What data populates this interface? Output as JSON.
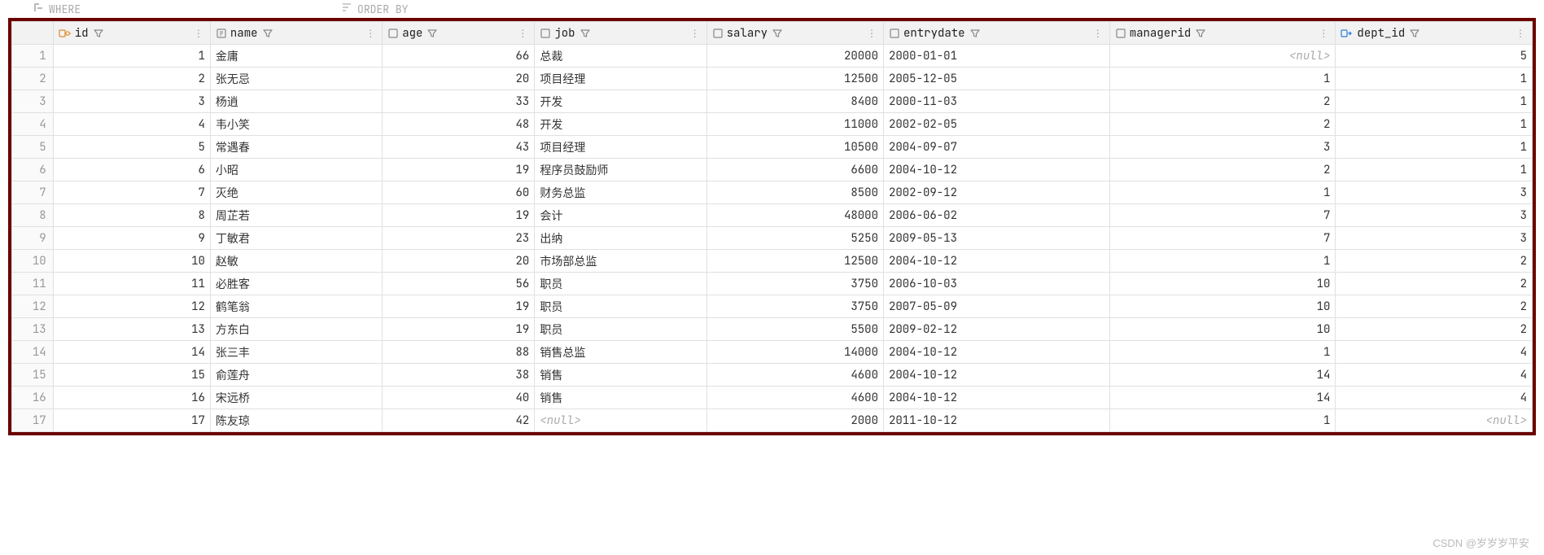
{
  "topbar": {
    "where_label": "WHERE",
    "orderby_label": "ORDER BY"
  },
  "null_display": "<null>",
  "columns": [
    {
      "key": "id",
      "label": "id",
      "icon": "key",
      "align": "num"
    },
    {
      "key": "name",
      "label": "name",
      "icon": "text",
      "align": "text"
    },
    {
      "key": "age",
      "label": "age",
      "icon": "col",
      "align": "num"
    },
    {
      "key": "job",
      "label": "job",
      "icon": "col",
      "align": "text"
    },
    {
      "key": "salary",
      "label": "salary",
      "icon": "col",
      "align": "num"
    },
    {
      "key": "entrydate",
      "label": "entrydate",
      "icon": "col",
      "align": "text"
    },
    {
      "key": "managerid",
      "label": "managerid",
      "icon": "col",
      "align": "num"
    },
    {
      "key": "dept_id",
      "label": "dept_id",
      "icon": "fk",
      "align": "num"
    }
  ],
  "rows": [
    {
      "id": 1,
      "name": "金庸",
      "age": 66,
      "job": "总裁",
      "salary": 20000,
      "entrydate": "2000-01-01",
      "managerid": null,
      "dept_id": 5
    },
    {
      "id": 2,
      "name": "张无忌",
      "age": 20,
      "job": "项目经理",
      "salary": 12500,
      "entrydate": "2005-12-05",
      "managerid": 1,
      "dept_id": 1
    },
    {
      "id": 3,
      "name": "杨逍",
      "age": 33,
      "job": "开发",
      "salary": 8400,
      "entrydate": "2000-11-03",
      "managerid": 2,
      "dept_id": 1
    },
    {
      "id": 4,
      "name": "韦小笑",
      "age": 48,
      "job": "开发",
      "salary": 11000,
      "entrydate": "2002-02-05",
      "managerid": 2,
      "dept_id": 1
    },
    {
      "id": 5,
      "name": "常遇春",
      "age": 43,
      "job": "项目经理",
      "salary": 10500,
      "entrydate": "2004-09-07",
      "managerid": 3,
      "dept_id": 1
    },
    {
      "id": 6,
      "name": "小昭",
      "age": 19,
      "job": "程序员鼓励师",
      "salary": 6600,
      "entrydate": "2004-10-12",
      "managerid": 2,
      "dept_id": 1
    },
    {
      "id": 7,
      "name": "灭绝",
      "age": 60,
      "job": "财务总监",
      "salary": 8500,
      "entrydate": "2002-09-12",
      "managerid": 1,
      "dept_id": 3
    },
    {
      "id": 8,
      "name": "周芷若",
      "age": 19,
      "job": "会计",
      "salary": 48000,
      "entrydate": "2006-06-02",
      "managerid": 7,
      "dept_id": 3
    },
    {
      "id": 9,
      "name": "丁敏君",
      "age": 23,
      "job": "出纳",
      "salary": 5250,
      "entrydate": "2009-05-13",
      "managerid": 7,
      "dept_id": 3
    },
    {
      "id": 10,
      "name": "赵敏",
      "age": 20,
      "job": "市场部总监",
      "salary": 12500,
      "entrydate": "2004-10-12",
      "managerid": 1,
      "dept_id": 2
    },
    {
      "id": 11,
      "name": "必胜客",
      "age": 56,
      "job": "职员",
      "salary": 3750,
      "entrydate": "2006-10-03",
      "managerid": 10,
      "dept_id": 2
    },
    {
      "id": 12,
      "name": "鹤笔翁",
      "age": 19,
      "job": "职员",
      "salary": 3750,
      "entrydate": "2007-05-09",
      "managerid": 10,
      "dept_id": 2
    },
    {
      "id": 13,
      "name": "方东白",
      "age": 19,
      "job": "职员",
      "salary": 5500,
      "entrydate": "2009-02-12",
      "managerid": 10,
      "dept_id": 2
    },
    {
      "id": 14,
      "name": "张三丰",
      "age": 88,
      "job": "销售总监",
      "salary": 14000,
      "entrydate": "2004-10-12",
      "managerid": 1,
      "dept_id": 4
    },
    {
      "id": 15,
      "name": "俞莲舟",
      "age": 38,
      "job": "销售",
      "salary": 4600,
      "entrydate": "2004-10-12",
      "managerid": 14,
      "dept_id": 4
    },
    {
      "id": 16,
      "name": "宋远桥",
      "age": 40,
      "job": "销售",
      "salary": 4600,
      "entrydate": "2004-10-12",
      "managerid": 14,
      "dept_id": 4
    },
    {
      "id": 17,
      "name": "陈友琼",
      "age": 42,
      "job": null,
      "salary": 2000,
      "entrydate": "2011-10-12",
      "managerid": 1,
      "dept_id": null
    }
  ],
  "watermark": "CSDN @岁岁岁平安"
}
